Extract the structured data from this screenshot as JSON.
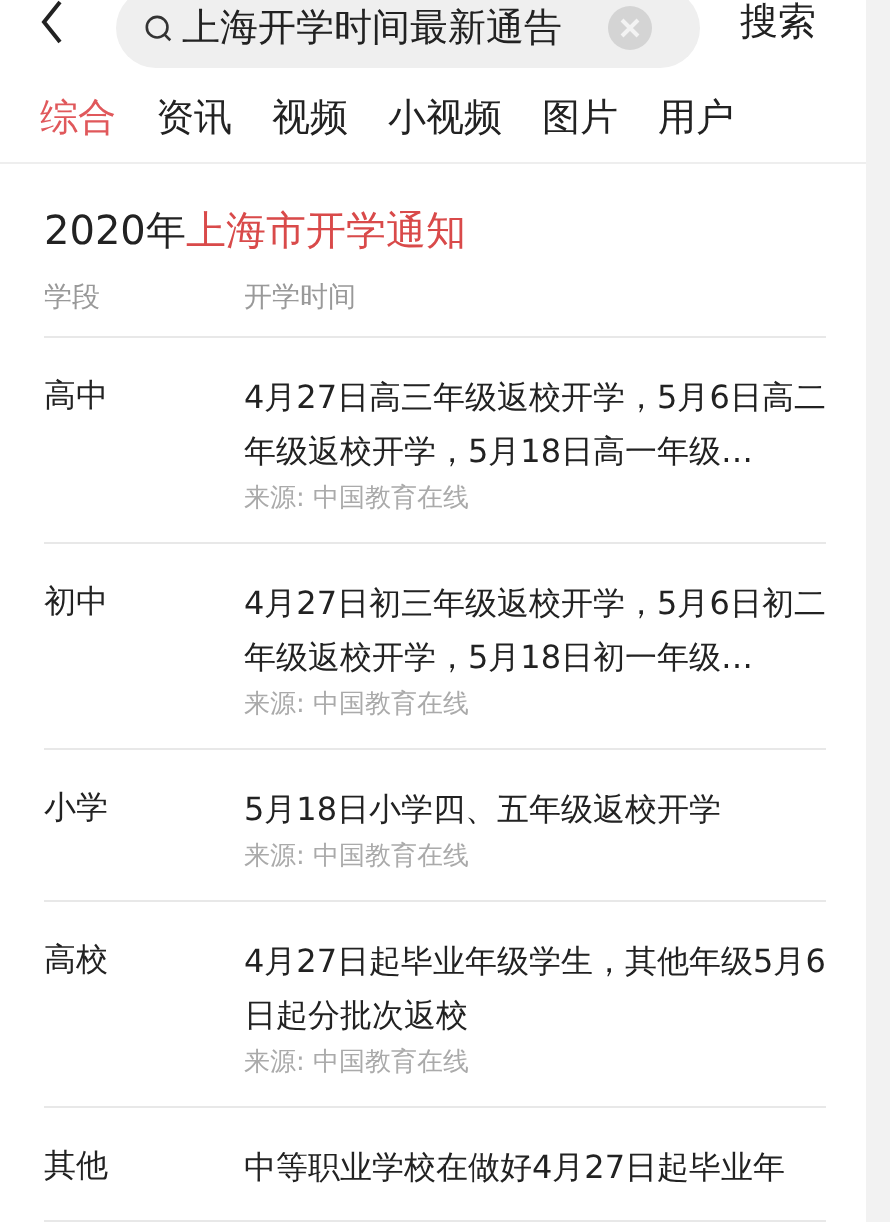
{
  "search": {
    "value": "上海开学时间最新通告",
    "button": "搜索"
  },
  "tabs": [
    {
      "label": "综合",
      "selected": true
    },
    {
      "label": "资讯",
      "selected": false
    },
    {
      "label": "视频",
      "selected": false
    },
    {
      "label": "小视频",
      "selected": false
    },
    {
      "label": "图片",
      "selected": false
    },
    {
      "label": "用户",
      "selected": false
    }
  ],
  "card": {
    "title": "2020年**上海市开学通知**",
    "columns": [
      "学段",
      "开学时间"
    ],
    "rows": [
      {
        "level": "高中",
        "text": "4月27日高三年级返校开学，5月6日高二年级返校开学，5月18日高一年级…",
        "source": "来源: 中国教育在线"
      },
      {
        "level": "初中",
        "text": "4月27日初三年级返校开学，5月6日初二年级返校开学，5月18日初一年级…",
        "source": "来源: 中国教育在线"
      },
      {
        "level": "小学",
        "text": "5月18日小学四、五年级返校开学",
        "source": "来源: 中国教育在线"
      },
      {
        "level": "高校",
        "text": "4月27日起毕业年级学生，其他年级5月6日起分批次返校",
        "source": "来源: 中国教育在线"
      },
      {
        "level": "其他",
        "text": "中等职业学校在做好4月27日起毕业年"
      }
    ]
  }
}
